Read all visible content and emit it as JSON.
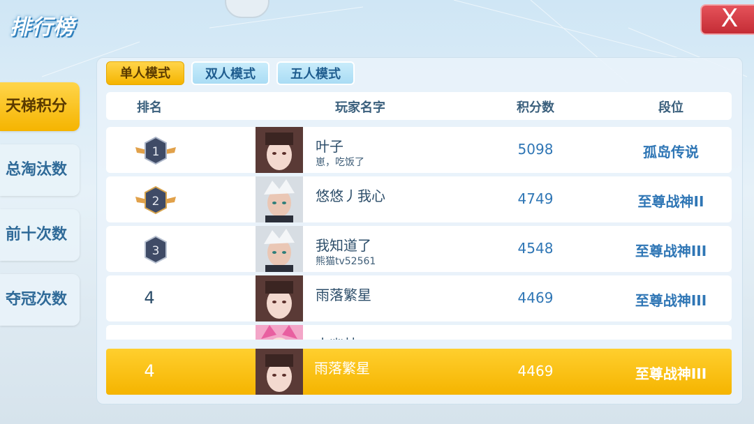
{
  "page_title": "排行榜",
  "close_label": "X",
  "side_tabs": [
    {
      "label": "天梯积分",
      "active": true
    },
    {
      "label": "总淘汰数",
      "active": false
    },
    {
      "label": "前十次数",
      "active": false
    },
    {
      "label": "夺冠次数",
      "active": false
    }
  ],
  "mode_tabs": [
    {
      "label": "单人模式",
      "active": true
    },
    {
      "label": "双人模式",
      "active": false
    },
    {
      "label": "五人模式",
      "active": false
    }
  ],
  "table_headers": {
    "rank": "排名",
    "player": "玩家名字",
    "score": "积分数",
    "segment": "段位"
  },
  "rows": [
    {
      "rank": "1",
      "name": "叶子",
      "subtitle": "崽，吃饭了",
      "score": "5098",
      "segment": "孤岛传说",
      "avatar": "girl-dark-hair"
    },
    {
      "rank": "2",
      "name": "悠悠丿我心",
      "subtitle": "",
      "score": "4749",
      "segment": "至尊战神II",
      "avatar": "boy-silver-hair"
    },
    {
      "rank": "3",
      "name": "我知道了",
      "subtitle": "熊猫tv52561",
      "score": "4548",
      "segment": "至尊战神III",
      "avatar": "boy-silver-hair"
    },
    {
      "rank": "4",
      "name": "雨落繁星",
      "subtitle": "",
      "score": "4469",
      "segment": "至尊战神III",
      "avatar": "girl-dark-hair"
    },
    {
      "rank": "",
      "name": "水幽林",
      "subtitle": "",
      "score": "",
      "segment": "",
      "avatar": "girl-pink-hair"
    }
  ],
  "self_row": {
    "rank": "4",
    "name": "雨落繁星",
    "score": "4469",
    "segment": "至尊战神III",
    "avatar": "girl-dark-hair"
  },
  "colors": {
    "accent_yellow": "#f5b400",
    "score_blue": "#2f76b5",
    "close_red": "#d23a43"
  }
}
